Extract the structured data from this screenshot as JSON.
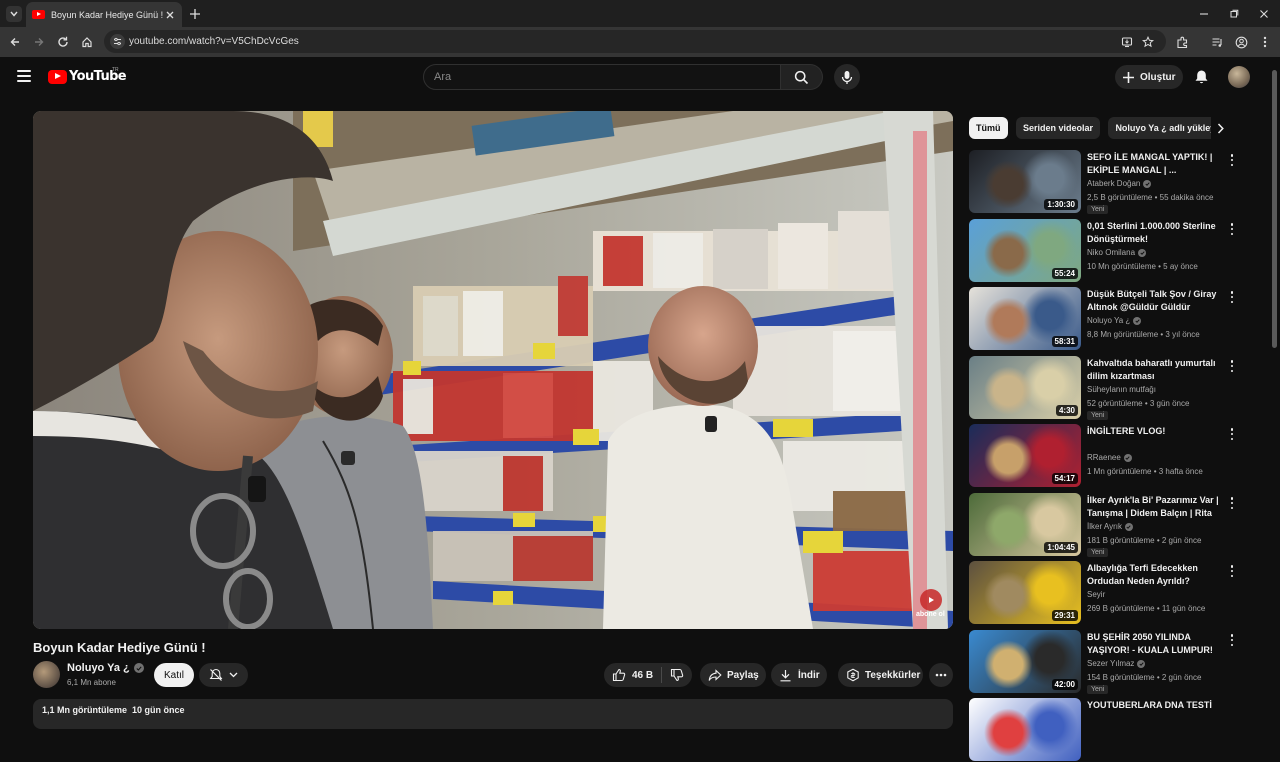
{
  "browser": {
    "tab_title": "Boyun Kadar Hediye Günü ! - YouTube",
    "url": "youtube.com/watch?v=V5ChDcVcGes"
  },
  "masthead": {
    "logo_text": "YouTube",
    "logo_country": "TR",
    "search_placeholder": "Ara",
    "create_label": "Oluştur"
  },
  "video": {
    "title": "Boyun Kadar Hediye Günü !",
    "channel": "Noluyo Ya ¿",
    "subscribers": "6,1 Mn abone",
    "join_label": "Katıl",
    "likes": "46 B",
    "share_label": "Paylaş",
    "download_label": "İndir",
    "thanks_label": "Teşekkürler",
    "views_date": "1,1 Mn görüntüleme  10 gün önce",
    "watermark": "abone ol"
  },
  "chips": [
    "Tümü",
    "Seriden videolar",
    "Noluyo Ya ¿ adlı yükleyiciden"
  ],
  "recommendations": [
    {
      "title": "SEFO İLE MANGAL YAPTIK! | EKİPLE MANGAL | ...",
      "channel": "Ataberk Doğan",
      "meta": "2,5 B görüntüleme • 55 dakika önce",
      "badge": "Yeni",
      "duration": "1:30:30",
      "verified": true,
      "thumb": [
        "#1d1f24",
        "#4a3c32",
        "#6b7c8c"
      ]
    },
    {
      "title": "0,01 Sterlini 1.000.000 Sterline Dönüştürmek!",
      "channel": "Niko Omilana",
      "meta": "10 Mn görüntüleme • 5 ay önce",
      "badge": "",
      "duration": "55:24",
      "verified": true,
      "thumb": [
        "#5aa0d8",
        "#8a6a4a",
        "#7fa880"
      ]
    },
    {
      "title": "Düşük Bütçeli Talk Şov / Giray Altınok @Güldür Güldür",
      "channel": "Noluyo Ya ¿",
      "meta": "8,8 Mn görüntüleme • 3 yıl önce",
      "badge": "",
      "duration": "58:31",
      "verified": true,
      "thumb": [
        "#e6e2da",
        "#b07a5a",
        "#3a5a8a"
      ]
    },
    {
      "title": "Kahvaltıda baharatlı yumurtalı dilim kızartması",
      "channel": "Süheylanın mutfağı",
      "meta": "52 görüntüleme • 3 gün önce",
      "badge": "Yeni",
      "duration": "4:30",
      "verified": false,
      "thumb": [
        "#6a7f86",
        "#c9b48a",
        "#d9cfa8"
      ]
    },
    {
      "title": "İNGİLTERE VLOG!",
      "channel": "RRaenee",
      "meta": "1 Mn görüntüleme • 3 hafta önce",
      "badge": "",
      "duration": "54:17",
      "verified": true,
      "thumb": [
        "#1a2c5a",
        "#c7a06a",
        "#b02030"
      ]
    },
    {
      "title": "İlker Ayrık'la Bi' Pazarımız Var | Tanışma | Didem Balçın | Rita ...",
      "channel": "İlker Ayrık",
      "meta": "181 B görüntüleme • 2 gün önce",
      "badge": "Yeni",
      "duration": "1:04:45",
      "verified": true,
      "thumb": [
        "#4d6b3a",
        "#8ea86a",
        "#d8c8a0"
      ]
    },
    {
      "title": "Albaylığa Terfi Edecekken Ordudan Neden Ayrıldı?",
      "channel": "Seyir",
      "meta": "269 B görüntüleme • 11 gün önce",
      "badge": "",
      "duration": "29:31",
      "verified": false,
      "thumb": [
        "#5c5040",
        "#a08a60",
        "#e8c020"
      ]
    },
    {
      "title": "BU ŞEHİR 2050 YILINDA YAŞIYOR! - KUALA LUMPUR!",
      "channel": "Sezer Yılmaz",
      "meta": "154 B görüntüleme • 2 gün önce",
      "badge": "Yeni",
      "duration": "42:00",
      "verified": true,
      "thumb": [
        "#3a8ad0",
        "#d0b070",
        "#2a2a2a"
      ]
    },
    {
      "title": "YOUTUBERLARA DNA TESTİ",
      "channel": "",
      "meta": "",
      "badge": "",
      "duration": "",
      "verified": false,
      "thumb": [
        "#ffffff",
        "#e04040",
        "#4060c0"
      ]
    }
  ]
}
